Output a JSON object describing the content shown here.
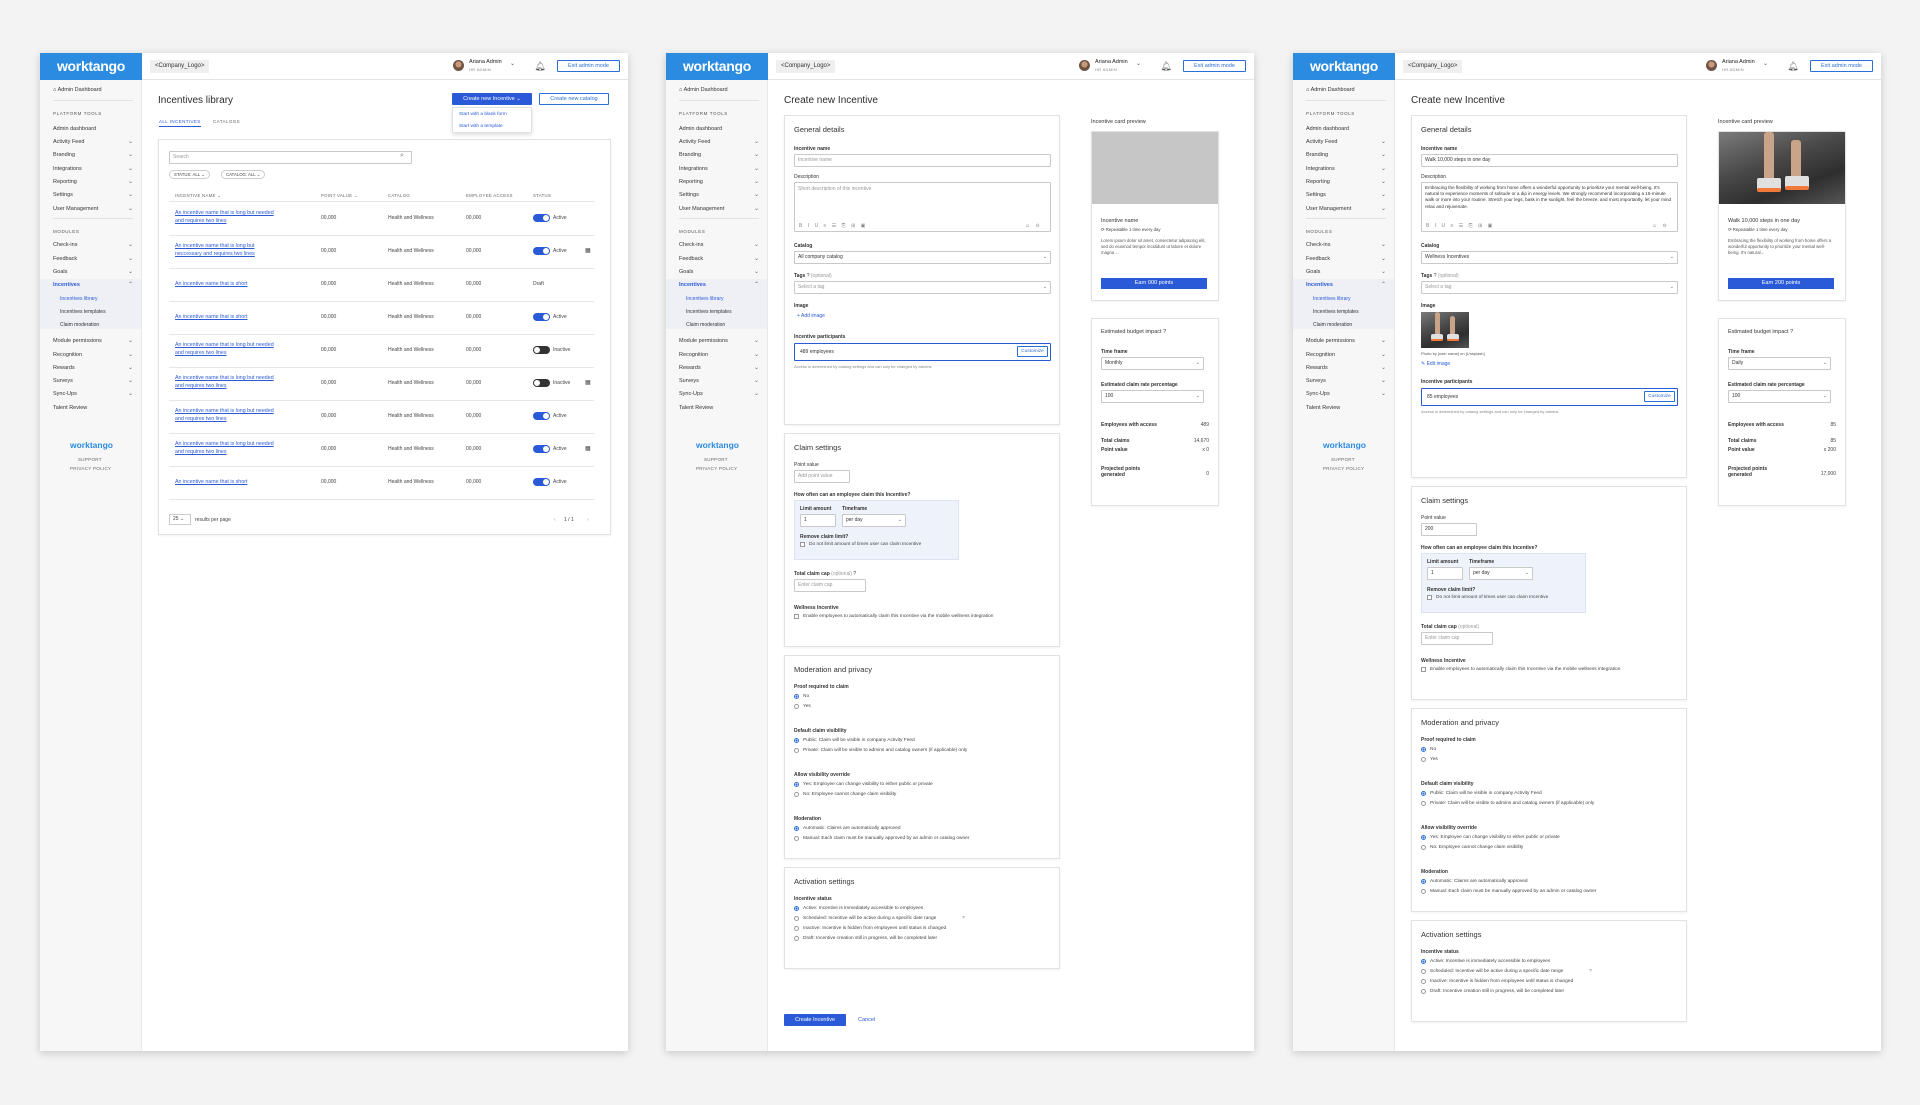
{
  "brand": "worktango",
  "company_logo": "<Company_Logo>",
  "user": {
    "name": "Ariana Admin",
    "role": "HR ADMIN"
  },
  "exit_admin": "Exit admin mode",
  "sidebar": {
    "dashboard": "Admin Dashboard",
    "platform_tools": "PLATFORM TOOLS",
    "tools": [
      "Admin dashboard",
      "Activity Feed",
      "Branding",
      "Integrations",
      "Reporting",
      "Settings",
      "User Management"
    ],
    "modules_head": "MODULES",
    "modules_a": [
      "Check-ins",
      "Feedback",
      "Goals",
      "Incentives"
    ],
    "incentive_subs": [
      "Incentives library",
      "Incentives templates",
      "Claim moderation"
    ],
    "modules_b": [
      "Module permissions",
      "Recognition",
      "Rewards",
      "Surveys",
      "Sync-Ups",
      "Talent Review"
    ],
    "support": "SUPPORT",
    "privacy": "PRIVACY POLICY"
  },
  "library": {
    "title": "Incentives library",
    "create_new": "Create new Incentive",
    "create_catalog": "Create new catalog",
    "menu": [
      "Start with a blank form",
      "Start with a template"
    ],
    "tabs": [
      "ALL INCENTIVES",
      "CATALOGS"
    ],
    "search_placeholder": "Search",
    "filters": [
      "STATUS: ALL",
      "CATALOG: ALL"
    ],
    "headers": [
      "INCENTIVE NAME",
      "POINT VALUE",
      "CATALOG",
      "EMPLOYEE ACCESS",
      "STATUS"
    ],
    "rows": [
      {
        "n1": "An incentive name that is long but needed",
        "n2": "and requires two lines",
        "pts": "00,000",
        "cat": "Health and Wellness",
        "acc": "00,000",
        "status": "Active",
        "tog": "on",
        "cal": false
      },
      {
        "n1": "An incentive name that is long but",
        "n2": "neccessary and requires two lines",
        "pts": "00,000",
        "cat": "Health and Wellness",
        "acc": "00,000",
        "status": "Active",
        "tog": "on",
        "cal": true
      },
      {
        "n1": "An incentive name that is short",
        "n2": "",
        "pts": "00,000",
        "cat": "Health and Wellness",
        "acc": "00,000",
        "status": "Draft",
        "tog": "none",
        "cal": false
      },
      {
        "n1": "An incentive name that is short",
        "n2": "",
        "pts": "00,000",
        "cat": "Health and Wellness",
        "acc": "00,000",
        "status": "Active",
        "tog": "on",
        "cal": false
      },
      {
        "n1": "An incentive name that is long but needed",
        "n2": "and requires two lines",
        "pts": "00,000",
        "cat": "Health and Wellness",
        "acc": "00,000",
        "status": "Inactive",
        "tog": "off",
        "cal": false
      },
      {
        "n1": "An incentive name that is long but needed",
        "n2": "and requires two lines",
        "pts": "00,000",
        "cat": "Health and Wellness",
        "acc": "00,000",
        "status": "Inactive",
        "tog": "off",
        "cal": true
      },
      {
        "n1": "An incentive name that is long but needed",
        "n2": "and requires two lines",
        "pts": "00,000",
        "cat": "Health and Wellness",
        "acc": "00,000",
        "status": "Active",
        "tog": "on",
        "cal": false
      },
      {
        "n1": "An incentive name that is long but needed",
        "n2": "and requires two lines",
        "pts": "00,000",
        "cat": "Health and Wellness",
        "acc": "00,000",
        "status": "Active",
        "tog": "on",
        "cal": true
      },
      {
        "n1": "An incentive name that is short",
        "n2": "",
        "pts": "00,000",
        "cat": "Health and Wellness",
        "acc": "00,000",
        "status": "Active",
        "tog": "on",
        "cal": false
      }
    ],
    "per_page": "25",
    "results_per_page": "results per page",
    "pagination": "1 / 1"
  },
  "form": {
    "title": "Create new Incentive",
    "general": "General details",
    "name_label": "Incentive name",
    "name_ph": "Incentive name",
    "desc_label": "Description",
    "desc_ph": "Short description of this incentive",
    "catalog_label": "Catalog",
    "catalog_val": "All company catalog",
    "tags_label": "Tags",
    "optional": "(optional)",
    "tags_ph": "Select a tag",
    "image_label": "Image",
    "add_image": "+ Add image",
    "participants_label": "Incentive participants",
    "participants_val": "489 employees",
    "customize": "Customize",
    "participants_note": "Access is determined by catalog settings and can only be changed by admins.",
    "claim_settings": "Claim settings",
    "point_label": "Point value",
    "point_ph": "Add point value",
    "how_often": "How often can an employee claim this Incentive?",
    "limit_label": "Limit amount",
    "limit_val": "1",
    "timeframe_label": "Timeframe",
    "timeframe_val": "per day",
    "remove_limit": "Remove claim limit?",
    "remove_limit_opt": "Do not limit amount of times user can claim Incentive",
    "cap_label": "Total claim cap",
    "cap_ph": "Enter claim cap",
    "wellness_label": "Wellness Incentive",
    "wellness_opt": "Enable employees to automatically claim this Incentive via the mobile wellness integration",
    "moderation_privacy": "Moderation and privacy",
    "proof_label": "Proof required to claim",
    "proof_opts": [
      "No",
      "Yes"
    ],
    "visibility_label": "Default claim visibility",
    "visibility_opts": [
      "Public: Claim will be visible in company Activity Feed",
      "Private: Claim will be visible to admins and catalog owners (if applicable) only"
    ],
    "override_label": "Allow visibility override",
    "override_opts": [
      "Yes: Employee can change visibility to either public or private",
      "No: Employee cannot change claim visibility"
    ],
    "moderation_label": "Moderation",
    "moderation_opts": [
      "Automatic: Claims are automatically approved",
      "Manual: Each claim must be manually approved by an admin or catalog owner"
    ],
    "activation": "Activation settings",
    "status_label": "Incentive status",
    "status_opts": [
      "Active: Incentive is immediately accessible to employees",
      "Scheduled: Incentive will be active during a specific date range",
      "Inactive: Incentive is hidden from employees until status is changed",
      "Draft: Incentive creation still in progress, will be completed later"
    ],
    "create_btn": "Create Incentive",
    "cancel": "Cancel",
    "preview_title": "Incentive card preview",
    "preview_name": "Incentive name",
    "preview_rep": "Repeatable 1 time every day",
    "preview_desc": "Lorem ipsum dolor sit amet, consectetur adipiscing elit, sed do eiusmod tempor incididunt ut labore et dolore magna ...",
    "preview_earn": "Earn 000 points",
    "budget_title": "Estimated budget impact",
    "budget_timeframe_label": "Time frame",
    "budget_timeframe": "Monthly",
    "rate_label": "Estimated claim rate percentage",
    "rate_val": "100",
    "emp_access": "Employees with access",
    "emp_access_v": "489",
    "total_claims": "Total claims",
    "total_claims_v": "14,670",
    "point_value": "Point value",
    "point_value_v": "x 0",
    "projected": "Projected points generated",
    "projected_v": "0"
  },
  "filled": {
    "name_val": "Walk 10,000 steps in one day",
    "desc_val": "Embracing the flexibility of working from home offers a wonderful opportunity to prioritize your mental well-being. It's natural to experience moments of solitude or a dip in energy levels. We strongly recommend incorporating a 15-minute walk or more into your routine. Stretch your legs, bask in the sunlight, feel the breeze, and most importantly, let your mind relax and rejuvenate.",
    "catalog_val": "Wellness Incentives",
    "photo_credit": "Photo by [user name] on [Unsplash]",
    "edit_image": "Edit image",
    "participants_val": "85 employees",
    "point_val": "200",
    "preview_name": "Walk 10,000 steps in one day",
    "preview_desc": "Embracing the flexibility of working from home offers a wonderful opportunity to prioritize your mental well-being. It's natural...",
    "preview_earn": "Earn 200 points",
    "budget_timeframe": "Daily",
    "emp_access_v": "85",
    "total_claims_v": "85",
    "point_value_v": "x 200",
    "projected_v": "17,000"
  },
  "colors": {
    "brand": "#2b8be0",
    "primary": "#2b5ad8",
    "sidebar_bg": "#f7f7f7"
  }
}
